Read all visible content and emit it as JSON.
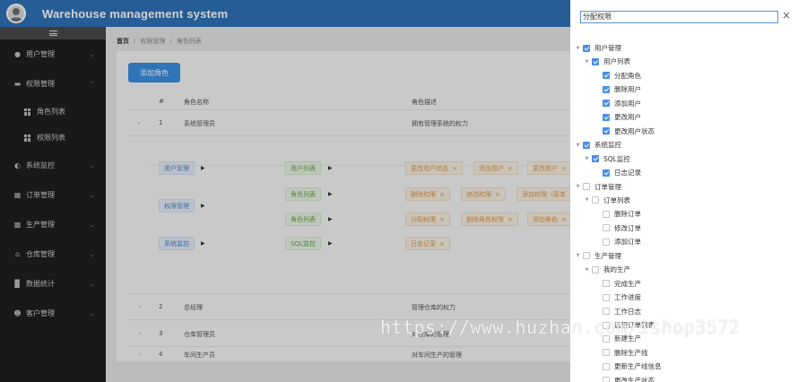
{
  "header": {
    "title": "Warehouse management system"
  },
  "sidebar": {
    "items": [
      {
        "label": "用户管理",
        "icon": "user-icon"
      },
      {
        "label": "权限管理",
        "icon": "monitor-icon",
        "expanded": true,
        "children": [
          {
            "label": "角色列表"
          },
          {
            "label": "权限列表"
          }
        ]
      },
      {
        "label": "系统监控",
        "icon": "gauge-icon"
      },
      {
        "label": "订单管理",
        "icon": "order-icon"
      },
      {
        "label": "生产管理",
        "icon": "clipboard-icon"
      },
      {
        "label": "仓库管理",
        "icon": "home-icon"
      },
      {
        "label": "数据统计",
        "icon": "bar-chart-icon"
      },
      {
        "label": "客户管理",
        "icon": "customer-icon"
      }
    ]
  },
  "breadcrumb": {
    "home": "首页",
    "level1": "权限管理",
    "level2": "角色列表"
  },
  "main": {
    "add_button": "添加角色",
    "columns": {
      "index": "#",
      "name": "角色名称",
      "desc": "角色描述"
    },
    "roles": [
      {
        "index": "1",
        "name": "系统管理员",
        "desc": "拥有管理系统的权力"
      },
      {
        "index": "2",
        "name": "总经理",
        "desc": "管理仓库的权力"
      },
      {
        "index": "3",
        "name": "仓库管理员",
        "desc": "对仓库的管理"
      },
      {
        "index": "4",
        "name": "车间生产员",
        "desc": "对车间生产的管理"
      }
    ],
    "expanded_perms": {
      "user_mgmt": "用户管理",
      "user_list": "用户列表",
      "user_list_tags": [
        "更改用户状态",
        "添加用户",
        "更改用户"
      ],
      "perm_mgmt": "权限管理",
      "role_list": "角色列表",
      "role_list_tags": [
        "删除权限",
        "修改权限",
        "添加权限（菜单"
      ],
      "perm_list": "角色列表",
      "perm_list_tags": [
        "分配权限",
        "删除角色权限",
        "添加角色"
      ],
      "sys_monitor": "系统监控",
      "sql_monitor": "SQL监控",
      "sql_tags": [
        "日志记录"
      ]
    }
  },
  "drawer": {
    "title": "分配权限",
    "tree": [
      {
        "label": "用户管理",
        "level": 0,
        "checked": true,
        "expand": "down"
      },
      {
        "label": "用户列表",
        "level": 1,
        "checked": true,
        "expand": "down"
      },
      {
        "label": "分配角色",
        "level": 2,
        "checked": true
      },
      {
        "label": "删除用户",
        "level": 2,
        "checked": true
      },
      {
        "label": "添加用户",
        "level": 2,
        "checked": true
      },
      {
        "label": "更改用户",
        "level": 2,
        "checked": true
      },
      {
        "label": "更改用户状态",
        "level": 2,
        "checked": true
      },
      {
        "label": "系统监控",
        "level": 0,
        "checked": true,
        "expand": "down"
      },
      {
        "label": "SQL监控",
        "level": 1,
        "checked": true,
        "expand": "down"
      },
      {
        "label": "日志记录",
        "level": 2,
        "checked": true
      },
      {
        "label": "订单管理",
        "level": 0,
        "checked": false,
        "expand": "down"
      },
      {
        "label": "订单列表",
        "level": 1,
        "checked": false,
        "expand": "down"
      },
      {
        "label": "删除订单",
        "level": 2,
        "checked": false
      },
      {
        "label": "修改订单",
        "level": 2,
        "checked": false
      },
      {
        "label": "添加订单",
        "level": 2,
        "checked": false
      },
      {
        "label": "生产管理",
        "level": 0,
        "checked": false,
        "expand": "down"
      },
      {
        "label": "我的生产",
        "level": 1,
        "checked": false,
        "expand": "down"
      },
      {
        "label": "完成生产",
        "level": 2,
        "checked": false
      },
      {
        "label": "工作进度",
        "level": 2,
        "checked": false
      },
      {
        "label": "工作日志",
        "level": 2,
        "checked": false
      },
      {
        "label": "远程订单列表",
        "level": 2,
        "checked": false
      },
      {
        "label": "新建生产",
        "level": 2,
        "checked": false
      },
      {
        "label": "删除生产线",
        "level": 2,
        "checked": false
      },
      {
        "label": "更新生产线信息",
        "level": 2,
        "checked": false
      },
      {
        "label": "更改生产状态",
        "level": 2,
        "checked": false
      }
    ]
  },
  "watermark": "https://www.huzhan.com/ishop3572"
}
